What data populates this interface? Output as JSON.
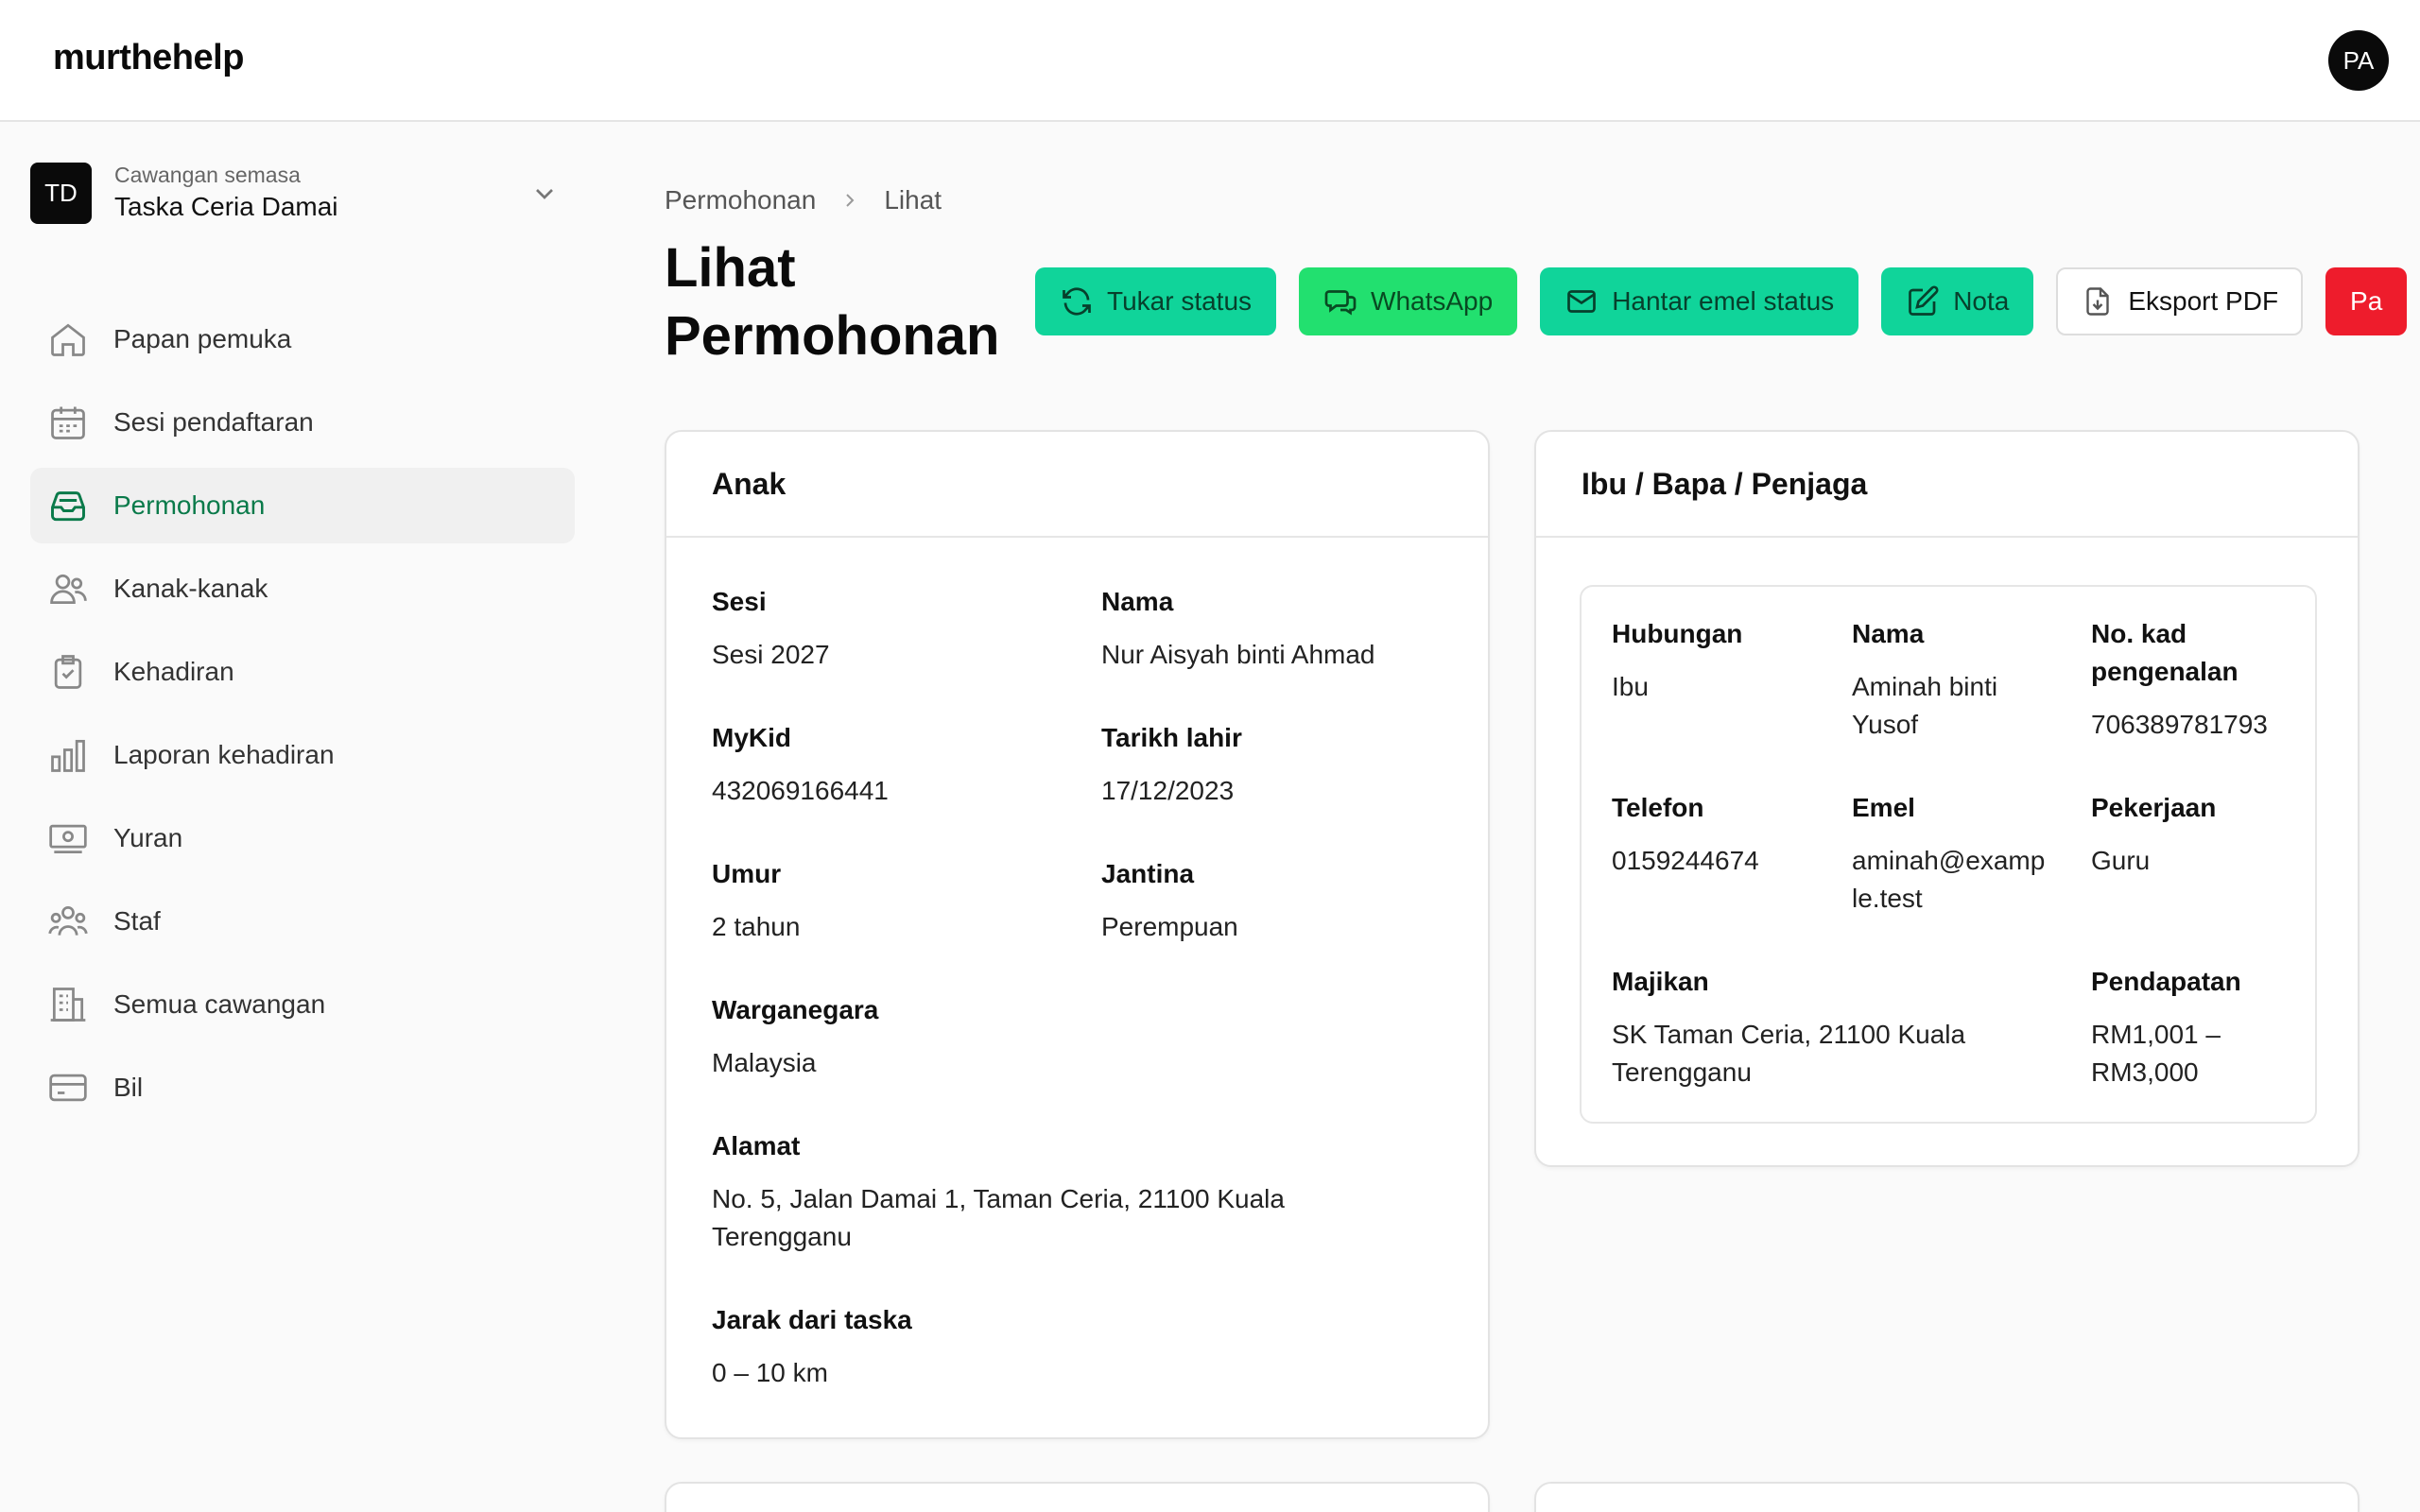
{
  "app": {
    "brand": "murthehelp",
    "user_initials": "PA"
  },
  "branch": {
    "initials": "TD",
    "caption": "Cawangan semasa",
    "name": "Taska Ceria Damai"
  },
  "nav": [
    {
      "label": "Papan pemuka",
      "icon": "home-icon"
    },
    {
      "label": "Sesi pendaftaran",
      "icon": "calendar-icon"
    },
    {
      "label": "Permohonan",
      "icon": "inbox-icon",
      "active": true
    },
    {
      "label": "Kanak-kanak",
      "icon": "users-icon"
    },
    {
      "label": "Kehadiran",
      "icon": "clipboard-check-icon"
    },
    {
      "label": "Laporan kehadiran",
      "icon": "bar-chart-icon"
    },
    {
      "label": "Yuran",
      "icon": "banknote-icon"
    },
    {
      "label": "Staf",
      "icon": "team-icon"
    },
    {
      "label": "Semua cawangan",
      "icon": "building-icon"
    },
    {
      "label": "Bil",
      "icon": "credit-card-icon"
    }
  ],
  "breadcrumb": {
    "parent": "Permohonan",
    "current": "Lihat"
  },
  "page": {
    "title": "Lihat Permohonan"
  },
  "actions": {
    "change_status": "Tukar status",
    "whatsapp": "WhatsApp",
    "email_status": "Hantar emel status",
    "note": "Nota",
    "export_pdf": "Eksport PDF",
    "danger_partial": "Pa"
  },
  "child_card": {
    "title": "Anak",
    "fields": {
      "session": {
        "label": "Sesi",
        "value": "Sesi 2027"
      },
      "name": {
        "label": "Nama",
        "value": "Nur Aisyah binti Ahmad"
      },
      "mykid": {
        "label": "MyKid",
        "value": "432069166441"
      },
      "dob": {
        "label": "Tarikh lahir",
        "value": "17/12/2023"
      },
      "age": {
        "label": "Umur",
        "value": "2 tahun"
      },
      "gender": {
        "label": "Jantina",
        "value": "Perempuan"
      },
      "citizenship": {
        "label": "Warganegara",
        "value": "Malaysia"
      },
      "address": {
        "label": "Alamat",
        "value": "No. 5, Jalan Damai 1, Taman Ceria, 21100 Kuala Terengganu"
      },
      "distance": {
        "label": "Jarak dari taska",
        "value": "0 – 10 km"
      }
    }
  },
  "guardian_card": {
    "title": "Ibu / Bapa / Penjaga",
    "fields": {
      "relation": {
        "label": "Hubungan",
        "value": "Ibu"
      },
      "name": {
        "label": "Nama",
        "value": "Aminah binti Yusof"
      },
      "ic": {
        "label": "No. kad pengenalan",
        "value": "706389781793"
      },
      "phone": {
        "label": "Telefon",
        "value": "0159244674"
      },
      "email": {
        "label": "Emel",
        "value": "aminah@example.test"
      },
      "job": {
        "label": "Pekerjaan",
        "value": "Guru"
      },
      "employer": {
        "label": "Majikan",
        "value": "SK Taman Ceria, 21100 Kuala Terengganu"
      },
      "income": {
        "label": "Pendapatan",
        "value": "RM1,001 – RM3,000"
      }
    }
  }
}
